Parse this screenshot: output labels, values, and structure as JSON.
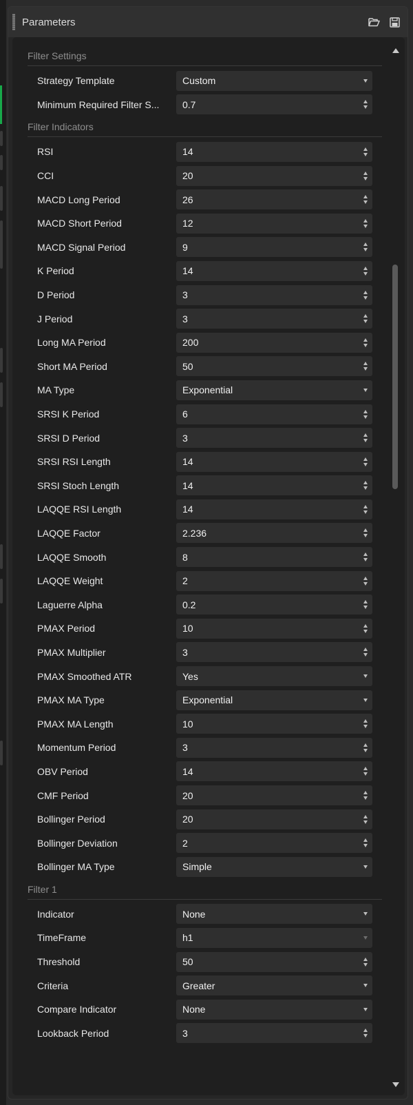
{
  "panel": {
    "title": "Parameters"
  },
  "header_icons": [
    "folder-open-icon",
    "save-icon"
  ],
  "accent_color": "#18a84a",
  "sections": [
    {
      "title": "Filter Settings",
      "params": [
        {
          "label": "Strategy Template",
          "value": "Custom",
          "control": "dropdown"
        },
        {
          "label": "Minimum Required Filter S...",
          "value": "0.7",
          "control": "spinner"
        }
      ]
    },
    {
      "title": "Filter Indicators",
      "params": [
        {
          "label": "RSI",
          "value": "14",
          "control": "spinner"
        },
        {
          "label": "CCI",
          "value": "20",
          "control": "spinner"
        },
        {
          "label": "MACD Long Period",
          "value": "26",
          "control": "spinner"
        },
        {
          "label": "MACD Short Period",
          "value": "12",
          "control": "spinner"
        },
        {
          "label": "MACD Signal Period",
          "value": "9",
          "control": "spinner"
        },
        {
          "label": "K Period",
          "value": "14",
          "control": "spinner"
        },
        {
          "label": "D Period",
          "value": "3",
          "control": "spinner"
        },
        {
          "label": "J Period",
          "value": "3",
          "control": "spinner"
        },
        {
          "label": "Long MA Period",
          "value": "200",
          "control": "spinner"
        },
        {
          "label": "Short MA Period",
          "value": "50",
          "control": "spinner"
        },
        {
          "label": "MA Type",
          "value": "Exponential",
          "control": "dropdown"
        },
        {
          "label": "SRSI K Period",
          "value": "6",
          "control": "spinner"
        },
        {
          "label": "SRSI D Period",
          "value": "3",
          "control": "spinner"
        },
        {
          "label": "SRSI RSI Length",
          "value": "14",
          "control": "spinner"
        },
        {
          "label": "SRSI Stoch Length",
          "value": "14",
          "control": "spinner"
        },
        {
          "label": "LAQQE RSI Length",
          "value": "14",
          "control": "spinner"
        },
        {
          "label": "LAQQE Factor",
          "value": "2.236",
          "control": "spinner"
        },
        {
          "label": "LAQQE Smooth",
          "value": "8",
          "control": "spinner"
        },
        {
          "label": "LAQQE Weight",
          "value": "2",
          "control": "spinner"
        },
        {
          "label": "Laguerre Alpha",
          "value": "0.2",
          "control": "spinner"
        },
        {
          "label": "PMAX Period",
          "value": "10",
          "control": "spinner"
        },
        {
          "label": "PMAX Multiplier",
          "value": "3",
          "control": "spinner"
        },
        {
          "label": "PMAX Smoothed ATR",
          "value": "Yes",
          "control": "dropdown"
        },
        {
          "label": "PMAX MA Type",
          "value": "Exponential",
          "control": "dropdown"
        },
        {
          "label": "PMAX MA Length",
          "value": "10",
          "control": "spinner"
        },
        {
          "label": "Momentum Period",
          "value": "3",
          "control": "spinner"
        },
        {
          "label": "OBV Period",
          "value": "14",
          "control": "spinner"
        },
        {
          "label": "CMF Period",
          "value": "20",
          "control": "spinner"
        },
        {
          "label": "Bollinger Period",
          "value": "20",
          "control": "spinner"
        },
        {
          "label": "Bollinger Deviation",
          "value": "2",
          "control": "spinner"
        },
        {
          "label": "Bollinger MA Type",
          "value": "Simple",
          "control": "dropdown"
        }
      ]
    },
    {
      "title": "Filter 1",
      "params": [
        {
          "label": "Indicator",
          "value": "None",
          "control": "dropdown"
        },
        {
          "label": "TimeFrame",
          "value": "h1",
          "control": "dropdown",
          "dim": true
        },
        {
          "label": "Threshold",
          "value": "50",
          "control": "spinner"
        },
        {
          "label": "Criteria",
          "value": "Greater",
          "control": "dropdown"
        },
        {
          "label": "Compare Indicator",
          "value": "None",
          "control": "dropdown"
        },
        {
          "label": "Lookback Period",
          "value": "3",
          "control": "spinner"
        }
      ]
    }
  ]
}
